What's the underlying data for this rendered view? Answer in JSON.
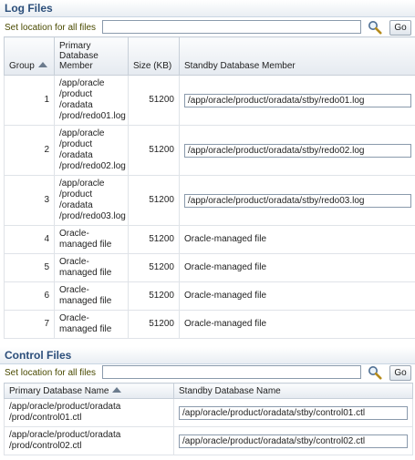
{
  "log_files": {
    "title": "Log Files",
    "location_label": "Set location for all files",
    "location_value": "",
    "go_label": "Go",
    "columns": {
      "group": "Group",
      "primary": "Primary Database Member",
      "size": "Size (KB)",
      "standby": "Standby Database Member"
    },
    "rows": [
      {
        "group": "1",
        "primary": "/app/oracle /product /oradata /prod/redo01.log",
        "size": "51200",
        "standby": "/app/oracle/product/oradata/stby/redo01.log"
      },
      {
        "group": "2",
        "primary": "/app/oracle /product /oradata /prod/redo02.log",
        "size": "51200",
        "standby": "/app/oracle/product/oradata/stby/redo02.log"
      },
      {
        "group": "3",
        "primary": "/app/oracle /product /oradata /prod/redo03.log",
        "size": "51200",
        "standby": "/app/oracle/product/oradata/stby/redo03.log"
      },
      {
        "group": "4",
        "primary": "Oracle-managed file",
        "size": "51200",
        "standby": "Oracle-managed file"
      },
      {
        "group": "5",
        "primary": "Oracle-managed file",
        "size": "51200",
        "standby": "Oracle-managed file"
      },
      {
        "group": "6",
        "primary": "Oracle-managed file",
        "size": "51200",
        "standby": "Oracle-managed file"
      },
      {
        "group": "7",
        "primary": "Oracle-managed file",
        "size": "51200",
        "standby": "Oracle-managed file"
      }
    ]
  },
  "control_files": {
    "title": "Control Files",
    "location_label": "Set location for all files",
    "location_value": "",
    "go_label": "Go",
    "columns": {
      "primary": "Primary Database Name",
      "standby": "Standby Database Name"
    },
    "rows": [
      {
        "primary": "/app/oracle/product/oradata /prod/control01.ctl",
        "standby": "/app/oracle/product/oradata/stby/control01.ctl"
      },
      {
        "primary": "/app/oracle/product/oradata /prod/control02.ctl",
        "standby": "/app/oracle/product/oradata/stby/control02.ctl"
      }
    ]
  },
  "icons": {
    "search": "search-icon (magnifier, gold handle)"
  }
}
